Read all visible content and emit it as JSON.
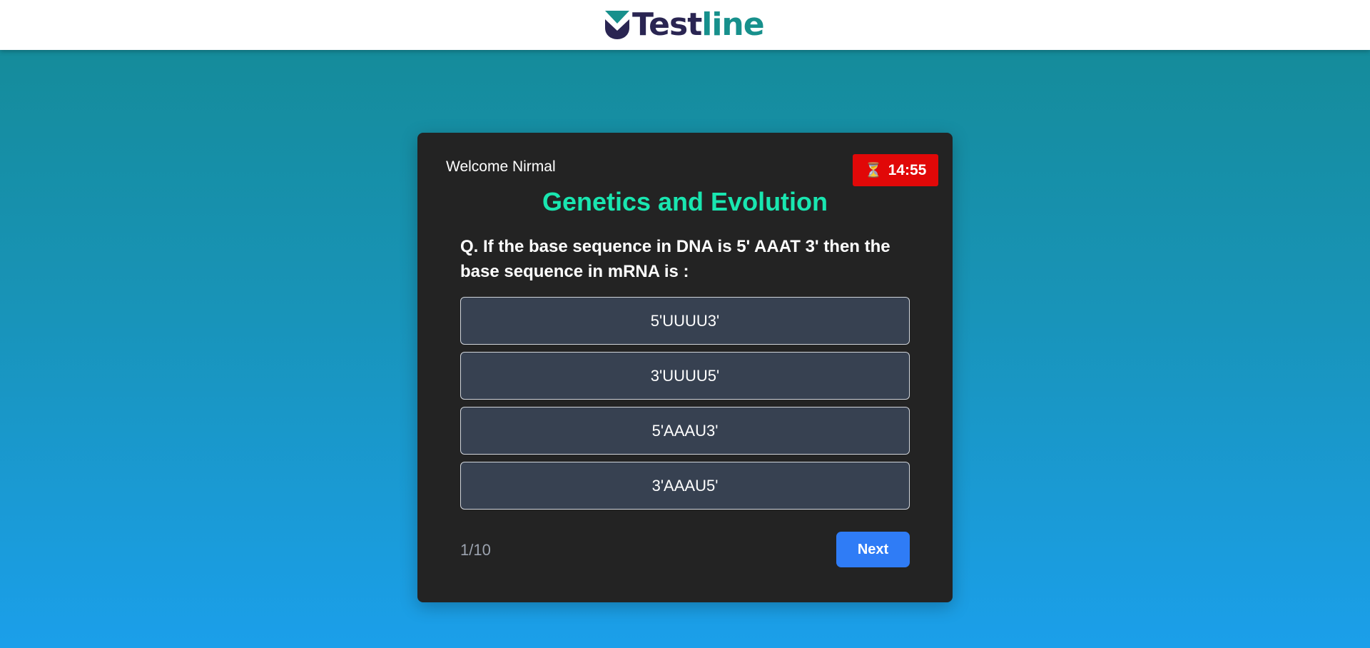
{
  "brand": {
    "name_part1": "Test",
    "name_part2": "line",
    "dark_color": "#2a2552",
    "accent_color": "#17908c"
  },
  "quiz": {
    "welcome": "Welcome Nirmal",
    "timer": "14:55",
    "timer_icon": "hourglass-icon",
    "title": "Genetics and Evolution",
    "question": "Q. If the base sequence in DNA is 5' AAAT 3' then the base sequence in mRNA is :",
    "options": [
      {
        "label": "5'UUUU3'"
      },
      {
        "label": "3'UUUU5'"
      },
      {
        "label": "5'AAAU3'"
      },
      {
        "label": "3'AAAU5'"
      }
    ],
    "progress": "1/10",
    "next_label": "Next"
  },
  "colors": {
    "timer_bg": "#e10808",
    "title": "#19e6b0",
    "option_bg": "#374151",
    "button": "#2f7cf6",
    "card_bg": "#232323"
  }
}
